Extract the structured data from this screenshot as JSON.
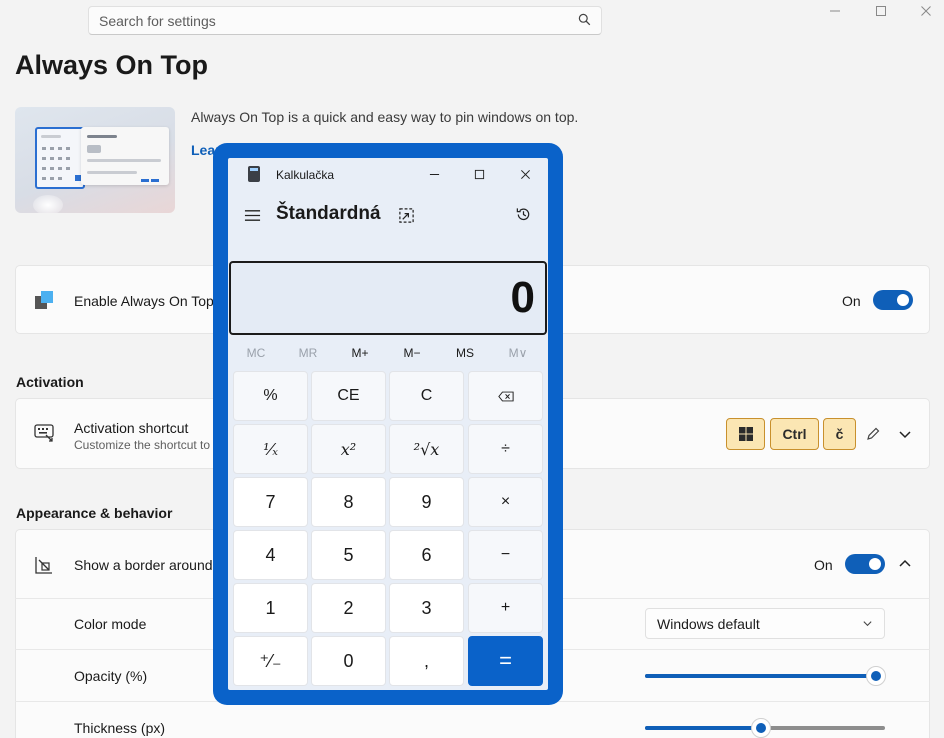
{
  "search": {
    "placeholder": "Search for settings"
  },
  "page": {
    "title": "Always On Top",
    "description": "Always On Top is a quick and easy way to pin windows on top.",
    "learn_more": "Lear"
  },
  "enable": {
    "label": "Enable Always On Top",
    "state": "On"
  },
  "activation": {
    "section": "Activation",
    "label": "Activation shortcut",
    "sub": "Customize the shortcut to",
    "keys": [
      "Ctrl",
      "č"
    ]
  },
  "appearance": {
    "section": "Appearance & behavior",
    "border_label": "Show a border around",
    "border_state": "On",
    "color_mode_label": "Color mode",
    "color_mode_value": "Windows default",
    "opacity_label": "Opacity (%)",
    "opacity_value": 1.0,
    "thickness_label": "Thickness (px)",
    "thickness_value": 0.5
  },
  "calculator": {
    "title": "Kalkulačka",
    "mode": "Štandardná",
    "display": "0",
    "memory": [
      "MC",
      "MR",
      "M+",
      "M−",
      "MS",
      "M∨"
    ],
    "buttons": [
      [
        "%",
        "CE",
        "C",
        "⌫"
      ],
      [
        "¹⁄ₓ",
        "x²",
        "²√x",
        "÷"
      ],
      [
        "7",
        "8",
        "9",
        "×"
      ],
      [
        "4",
        "5",
        "6",
        "−"
      ],
      [
        "1",
        "2",
        "3",
        "+"
      ],
      [
        "⁺⁄₋",
        "0",
        ",",
        "="
      ]
    ]
  },
  "colors": {
    "accent": "#0f5fb8",
    "calc_accent": "#0a62c9",
    "key_bg": "#fbe6b3"
  }
}
